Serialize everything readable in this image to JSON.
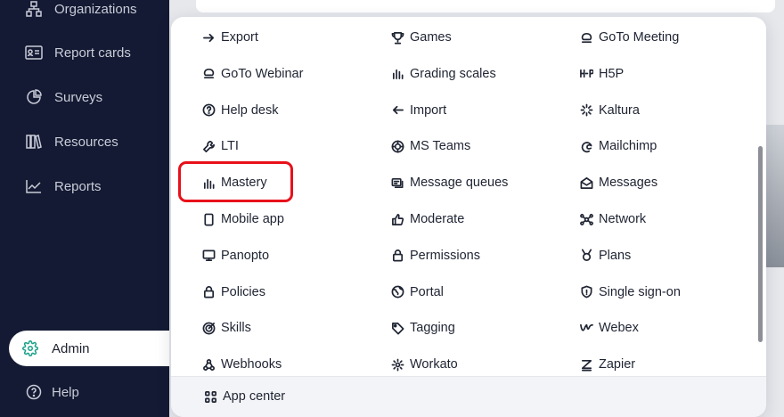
{
  "sidebar": {
    "items": [
      {
        "label": "Organizations",
        "icon": "organizations-icon"
      },
      {
        "label": "Report cards",
        "icon": "report-card-icon"
      },
      {
        "label": "Surveys",
        "icon": "pie-chart-icon"
      },
      {
        "label": "Resources",
        "icon": "books-icon"
      },
      {
        "label": "Reports",
        "icon": "line-chart-icon"
      }
    ],
    "admin": {
      "label": "Admin",
      "icon": "gear-icon",
      "accent": "#19a089"
    },
    "help": {
      "label": "Help",
      "icon": "help-circle-icon"
    }
  },
  "menu": {
    "columns": [
      [
        {
          "label": "Export",
          "icon": "arrow-right-icon"
        },
        {
          "label": "GoTo Webinar",
          "icon": "goto-icon"
        },
        {
          "label": "Help desk",
          "icon": "help-circle-icon"
        },
        {
          "label": "LTI",
          "icon": "wrench-icon"
        },
        {
          "label": "Mastery",
          "icon": "bar-chart-icon"
        },
        {
          "label": "Mobile app",
          "icon": "phone-icon"
        },
        {
          "label": "Panopto",
          "icon": "monitor-icon"
        },
        {
          "label": "Policies",
          "icon": "lock-icon"
        },
        {
          "label": "Skills",
          "icon": "target-icon"
        },
        {
          "label": "Webhooks",
          "icon": "webhook-icon"
        }
      ],
      [
        {
          "label": "Games",
          "icon": "trophy-icon"
        },
        {
          "label": "Grading scales",
          "icon": "bar-chart-icon"
        },
        {
          "label": "Import",
          "icon": "arrow-left-icon"
        },
        {
          "label": "MS Teams",
          "icon": "teams-icon"
        },
        {
          "label": "Message queues",
          "icon": "message-queue-icon"
        },
        {
          "label": "Moderate",
          "icon": "thumbs-up-icon"
        },
        {
          "label": "Permissions",
          "icon": "lock-icon"
        },
        {
          "label": "Portal",
          "icon": "globe-icon"
        },
        {
          "label": "Tagging",
          "icon": "tag-icon"
        },
        {
          "label": "Workato",
          "icon": "gear-icon"
        }
      ],
      [
        {
          "label": "GoTo Meeting",
          "icon": "goto-icon"
        },
        {
          "label": "H5P",
          "icon": "h5p-icon"
        },
        {
          "label": "Kaltura",
          "icon": "kaltura-icon"
        },
        {
          "label": "Mailchimp",
          "icon": "mailchimp-icon"
        },
        {
          "label": "Messages",
          "icon": "envelope-open-icon"
        },
        {
          "label": "Network",
          "icon": "network-icon"
        },
        {
          "label": "Plans",
          "icon": "medal-icon"
        },
        {
          "label": "Single sign-on",
          "icon": "shield-icon"
        },
        {
          "label": "Webex",
          "icon": "webex-icon"
        },
        {
          "label": "Zapier",
          "icon": "zapier-icon"
        }
      ]
    ],
    "highlighted_item": "Mastery",
    "highlight_color": "#e8101a",
    "footer": {
      "label": "App center",
      "icon": "app-grid-icon"
    }
  }
}
